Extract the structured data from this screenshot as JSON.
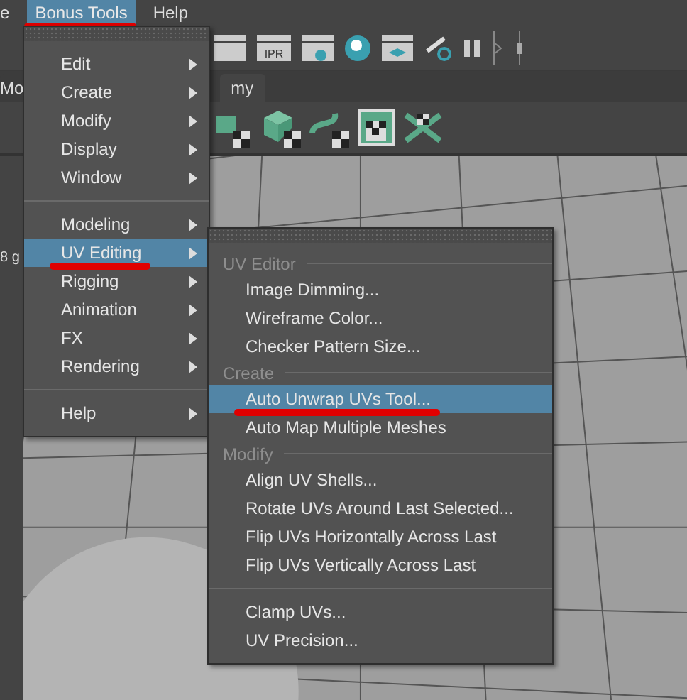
{
  "menubar": [
    {
      "label": "e",
      "selected": false,
      "underlined": false
    },
    {
      "label": "Bonus Tools",
      "selected": true,
      "underlined": true
    },
    {
      "label": "Help",
      "selected": false,
      "underlined": false
    }
  ],
  "toolbar": {
    "ipr_label": "IPR"
  },
  "tabs": [
    {
      "label": "Mo"
    },
    {
      "label": "my"
    }
  ],
  "side_label": "8 g",
  "menu": {
    "items": [
      {
        "kind": "item",
        "label": "Edit",
        "submenu": true,
        "selected": false,
        "underlined": false
      },
      {
        "kind": "item",
        "label": "Create",
        "submenu": true,
        "selected": false,
        "underlined": false
      },
      {
        "kind": "item",
        "label": "Modify",
        "submenu": true,
        "selected": false,
        "underlined": false
      },
      {
        "kind": "item",
        "label": "Display",
        "submenu": true,
        "selected": false,
        "underlined": false
      },
      {
        "kind": "item",
        "label": "Window",
        "submenu": true,
        "selected": false,
        "underlined": false
      },
      {
        "kind": "divider"
      },
      {
        "kind": "item",
        "label": "Modeling",
        "submenu": true,
        "selected": false,
        "underlined": false
      },
      {
        "kind": "item",
        "label": "UV Editing",
        "submenu": true,
        "selected": true,
        "underlined": true
      },
      {
        "kind": "item",
        "label": "Rigging",
        "submenu": true,
        "selected": false,
        "underlined": false
      },
      {
        "kind": "item",
        "label": "Animation",
        "submenu": true,
        "selected": false,
        "underlined": false
      },
      {
        "kind": "item",
        "label": "FX",
        "submenu": true,
        "selected": false,
        "underlined": false
      },
      {
        "kind": "item",
        "label": "Rendering",
        "submenu": true,
        "selected": false,
        "underlined": false
      },
      {
        "kind": "divider"
      },
      {
        "kind": "item",
        "label": "Help",
        "submenu": true,
        "selected": false,
        "underlined": false
      }
    ]
  },
  "submenu": {
    "items": [
      {
        "kind": "header",
        "label": "UV Editor"
      },
      {
        "kind": "item",
        "label": "Image Dimming...",
        "selected": false,
        "underlined": false
      },
      {
        "kind": "item",
        "label": "Wireframe Color...",
        "selected": false,
        "underlined": false
      },
      {
        "kind": "item",
        "label": "Checker Pattern Size...",
        "selected": false,
        "underlined": false
      },
      {
        "kind": "header",
        "label": "Create"
      },
      {
        "kind": "item",
        "label": "Auto Unwrap UVs Tool...",
        "selected": true,
        "underlined": true
      },
      {
        "kind": "item",
        "label": "Auto Map Multiple Meshes",
        "selected": false,
        "underlined": false
      },
      {
        "kind": "header",
        "label": "Modify"
      },
      {
        "kind": "item",
        "label": "Align UV Shells...",
        "selected": false,
        "underlined": false
      },
      {
        "kind": "item",
        "label": "Rotate UVs Around Last Selected...",
        "selected": false,
        "underlined": false
      },
      {
        "kind": "item",
        "label": "Flip UVs Horizontally Across Last",
        "selected": false,
        "underlined": false
      },
      {
        "kind": "item",
        "label": "Flip UVs Vertically Across Last",
        "selected": false,
        "underlined": false
      },
      {
        "kind": "divider"
      },
      {
        "kind": "item",
        "label": "Clamp UVs...",
        "selected": false,
        "underlined": false
      },
      {
        "kind": "item",
        "label": "UV Precision...",
        "selected": false,
        "underlined": false
      }
    ]
  }
}
